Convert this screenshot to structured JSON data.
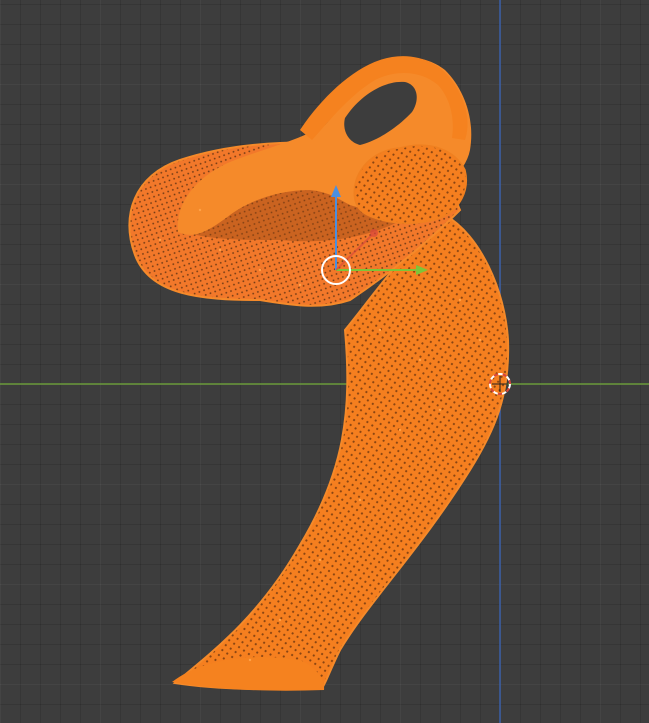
{
  "app": {
    "name": "3D viewport",
    "mode": "edit-mode-point-cloud"
  },
  "viewport": {
    "background_color": "#3d3d3d",
    "grid_line_color": "#4a4a4a",
    "x_axis_color": "#6a9a3a",
    "y_axis_color": "#3a5fa8"
  },
  "mesh": {
    "color": "#f57f1f",
    "shadow_color": "#c05a12",
    "vertex_color": "#ff9a3a"
  },
  "gizmo": {
    "x_color": "#d9463c",
    "y_color": "#7ec43a",
    "z_color": "#4b8fe0",
    "origin_ring_color": "#ffffff"
  },
  "icons": [
    "origin-ring-icon",
    "3d-cursor-icon",
    "transform-gizmo-icon"
  ]
}
